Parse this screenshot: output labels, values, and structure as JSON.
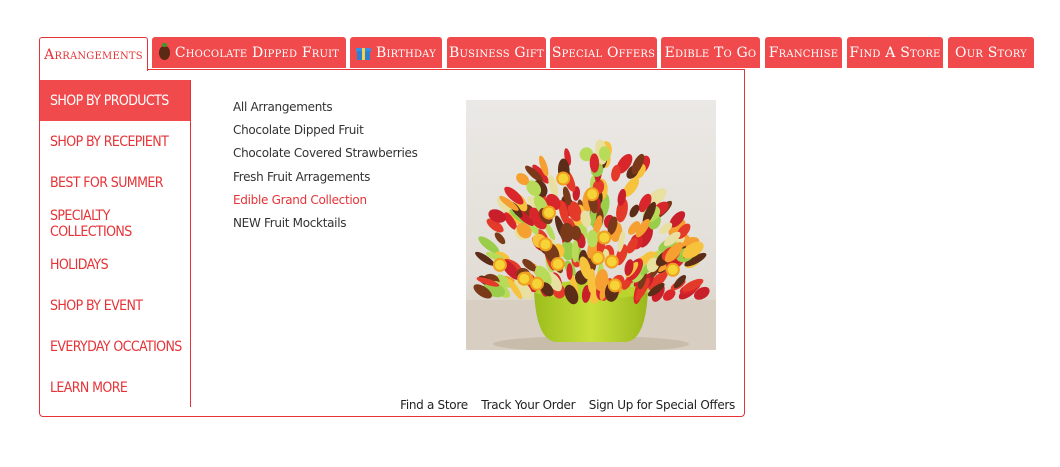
{
  "nav": {
    "tabs": [
      {
        "label": "Arrangements",
        "active": true,
        "icon": ""
      },
      {
        "label": "Chocolate Dipped Fruit",
        "active": false,
        "icon": "chocolate-berry-icon"
      },
      {
        "label": "Birthday",
        "active": false,
        "icon": "gift-icon"
      },
      {
        "label": "Business Gift",
        "active": false,
        "icon": ""
      },
      {
        "label": "Special Offers",
        "active": false,
        "icon": ""
      },
      {
        "label": "Edible To Go",
        "active": false,
        "icon": ""
      },
      {
        "label": "Franchise",
        "active": false,
        "icon": ""
      },
      {
        "label": "Find A Store",
        "active": false,
        "icon": ""
      },
      {
        "label": "Our Story",
        "active": false,
        "icon": ""
      }
    ]
  },
  "sidebar": {
    "items": [
      {
        "label": "Shop by Products",
        "active": true
      },
      {
        "label": "Shop by Recepient",
        "active": false
      },
      {
        "label": "Best for Summer",
        "active": false
      },
      {
        "label": "Specialty Collections",
        "active": false
      },
      {
        "label": "Holidays",
        "active": false
      },
      {
        "label": "Shop by Event",
        "active": false
      },
      {
        "label": "Everyday Occations",
        "active": false
      },
      {
        "label": "Learn More",
        "active": false
      }
    ]
  },
  "links": [
    {
      "label": "All Arrangements",
      "highlight": false
    },
    {
      "label": "Chocolate Dipped Fruit",
      "highlight": false
    },
    {
      "label": "Chocolate Covered Strawberries",
      "highlight": false
    },
    {
      "label": "Fresh Fruit Arragements",
      "highlight": false
    },
    {
      "label": "Edible Grand Collection",
      "highlight": true
    },
    {
      "label": "NEW Fruit Mocktails",
      "highlight": false
    }
  ],
  "footer": {
    "find_store": "Find a Store",
    "track_order": "Track Your Order",
    "sign_up": "Sign Up for Special Offers"
  },
  "colors": {
    "accent": "#f04a4c",
    "accent_text": "#e63337",
    "link_text": "#333333"
  }
}
